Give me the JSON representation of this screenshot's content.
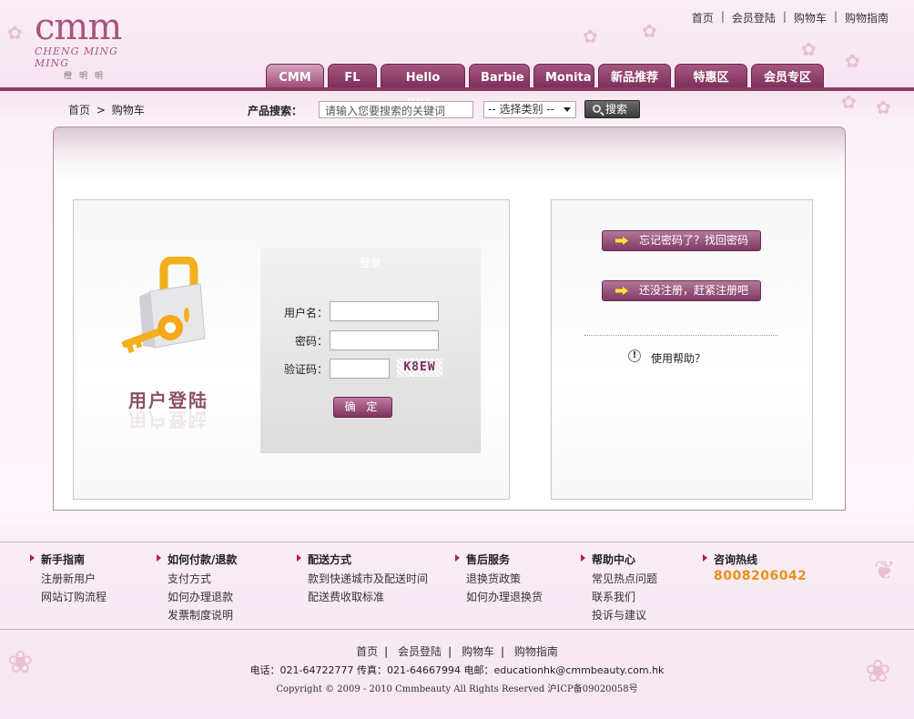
{
  "brand": {
    "name": "cmm",
    "sub": "CHENG MING MING",
    "cn": "橙明明"
  },
  "topnav": [
    {
      "label": "首页"
    },
    {
      "label": "会员登陆"
    },
    {
      "label": "购物车"
    },
    {
      "label": "购物指南"
    }
  ],
  "tabs": [
    {
      "label": "CMM"
    },
    {
      "label": "FL"
    },
    {
      "label": "Hello Kitty"
    },
    {
      "label": "Barbie"
    },
    {
      "label": "Monita"
    },
    {
      "label": "新品推荐"
    },
    {
      "label": "特惠区"
    },
    {
      "label": "会员专区"
    }
  ],
  "breadcrumb": {
    "home": "首页",
    "sep": ">",
    "current": "购物车"
  },
  "search": {
    "label": "产品搜索：",
    "value": "请输入您要搜索的关键词",
    "category": "-- 选择类别 --",
    "button": "搜索"
  },
  "login": {
    "title": "用户登陆",
    "form_header": "登录",
    "username_label": "用户名：",
    "password_label": "密码：",
    "captcha_label": "验证码：",
    "captcha_code": "K8EW",
    "submit": "确 定"
  },
  "side": {
    "forgot": "忘记密码了？找回密码",
    "register": "还没注册，赶紧注册吧",
    "help": "使用帮助？"
  },
  "footer": {
    "columns": [
      {
        "title": "新手指南",
        "links": [
          "注册新用户",
          "网站订购流程"
        ]
      },
      {
        "title": "如何付款/退款",
        "links": [
          "支付方式",
          "如何办理退款",
          "发票制度说明"
        ]
      },
      {
        "title": "配送方式",
        "links": [
          "款到快递城市及配送时间",
          "配送费收取标准"
        ]
      },
      {
        "title": "售后服务",
        "links": [
          "退换货政策",
          "如何办理退换货"
        ]
      },
      {
        "title": "帮助中心",
        "links": [
          "常见热点问题",
          "联系我们",
          "投诉与建议"
        ]
      },
      {
        "title": "咨询热线",
        "links": []
      }
    ],
    "hotline": "8008206042",
    "nav": [
      "首页",
      "会员登陆",
      "购物车",
      "购物指南"
    ],
    "contact": "电话：021-64722777 传真：021-64667994 电邮：educationhk@cmmbeauty.com.hk",
    "copyright": "Copyright © 2009 - 2010 Cmmbeauty All Rights Reserved 沪ICP备09020058号"
  },
  "colors": {
    "accent": "#8a3a64",
    "hotline": "#e8901a",
    "tab": "#7b2f59"
  }
}
